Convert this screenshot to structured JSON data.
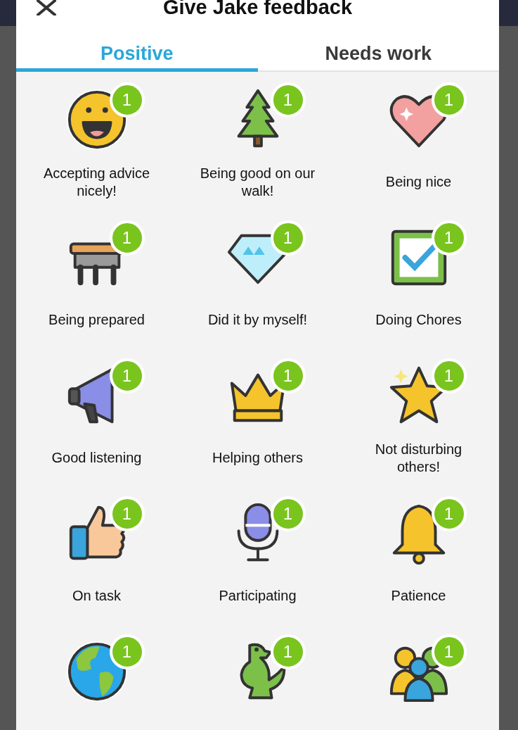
{
  "dialog": {
    "title": "Give Jake feedback"
  },
  "tabs": [
    {
      "label": "Positive",
      "selected": true
    },
    {
      "label": "Needs work",
      "selected": false
    }
  ],
  "behaviors": [
    {
      "label": "Accepting advice nicely!",
      "count": "1"
    },
    {
      "label": "Being good on our walk!",
      "count": "1"
    },
    {
      "label": "Being nice",
      "count": "1"
    },
    {
      "label": "Being prepared",
      "count": "1"
    },
    {
      "label": "Did it by myself!",
      "count": "1"
    },
    {
      "label": "Doing Chores",
      "count": "1"
    },
    {
      "label": "Good listening",
      "count": "1"
    },
    {
      "label": "Helping others",
      "count": "1"
    },
    {
      "label": "Not disturbing others!",
      "count": "1"
    },
    {
      "label": "On task",
      "count": "1"
    },
    {
      "label": "Participating",
      "count": "1"
    },
    {
      "label": "Patience",
      "count": "1"
    },
    {
      "count": "1"
    },
    {
      "count": "1"
    },
    {
      "count": "1"
    }
  ]
}
